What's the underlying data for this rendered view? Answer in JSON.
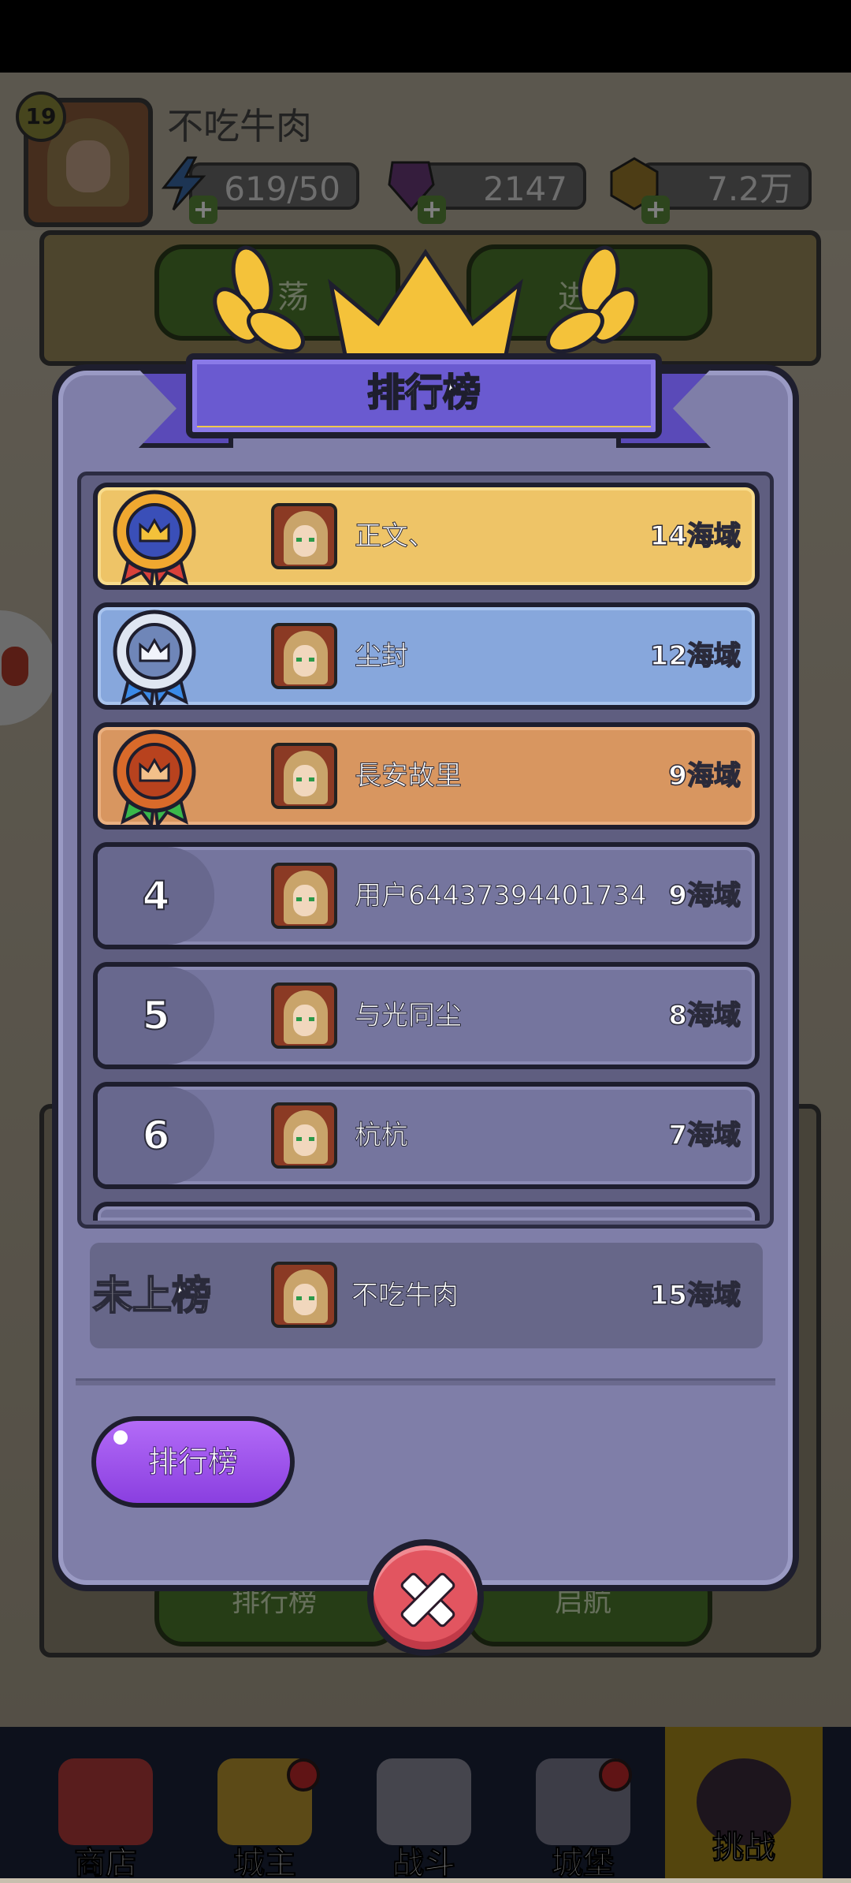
{
  "player": {
    "level": "19",
    "name": "不吃牛肉",
    "energy": "619/50",
    "gems": "2147",
    "gold": "7.2万"
  },
  "background": {
    "btn1": "荡",
    "btn2": "进",
    "btn3": "排行榜",
    "btn4": "启航"
  },
  "dialog": {
    "title": "排行榜",
    "tab_button": "排行榜"
  },
  "leaderboard": [
    {
      "rank": "1",
      "name": "正文、",
      "score": "14海域",
      "tier": "gold"
    },
    {
      "rank": "2",
      "name": "尘封",
      "score": "12海域",
      "tier": "silver"
    },
    {
      "rank": "3",
      "name": "長安故里",
      "score": "9海域",
      "tier": "bronze"
    },
    {
      "rank": "4",
      "name": "用户64437394401734",
      "score": "9海域",
      "tier": "plain"
    },
    {
      "rank": "5",
      "name": "与光同尘",
      "score": "8海域",
      "tier": "plain"
    },
    {
      "rank": "6",
      "name": "杭杭",
      "score": "7海域",
      "tier": "plain"
    }
  ],
  "my_rank": {
    "label": "未上榜",
    "name": "不吃牛肉",
    "score": "15海域"
  },
  "nav": [
    {
      "label": "商店",
      "icon": "shop-icon"
    },
    {
      "label": "城主",
      "icon": "crown-icon"
    },
    {
      "label": "战斗",
      "icon": "swords-icon"
    },
    {
      "label": "城堡",
      "icon": "castle-icon"
    },
    {
      "label": "挑战",
      "icon": "monster-icon"
    }
  ],
  "colors": {
    "gold_row": "#eec467",
    "silver_row": "#87a7dc",
    "bronze_row": "#d89660",
    "plain_row": "#75759e",
    "dialog": "#7f7ea8",
    "close": "#e25560",
    "tab_button": "#9a50ec"
  }
}
